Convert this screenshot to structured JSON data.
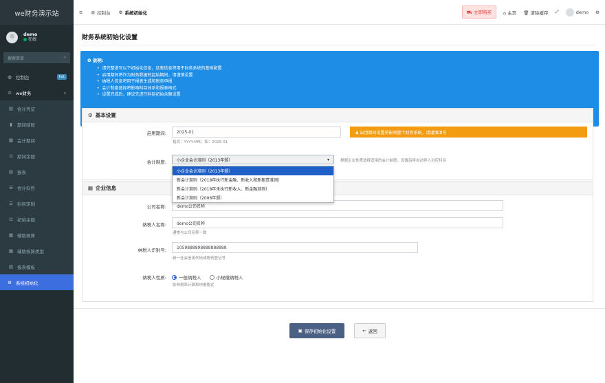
{
  "sidebar": {
    "brand": "we财务演示站",
    "user": {
      "name": "demo",
      "status": "在线"
    },
    "search_placeholder": "搜索菜单",
    "items": [
      {
        "label": "控制台",
        "icon": "dashboard-icon",
        "badge": "hot"
      },
      {
        "label": "we财务",
        "icon": "finance-icon"
      },
      {
        "label": "会计凭证",
        "icon": "voucher-icon"
      },
      {
        "label": "期间结账",
        "icon": "lock-icon"
      },
      {
        "label": "会计期间",
        "icon": "calendar-icon"
      },
      {
        "label": "期间余额",
        "icon": "balance-icon"
      },
      {
        "label": "报表",
        "icon": "report-icon"
      },
      {
        "label": "会计科目",
        "icon": "list-icon"
      },
      {
        "label": "科目定制",
        "icon": "list-icon"
      },
      {
        "label": "初始余额",
        "icon": "init-icon"
      },
      {
        "label": "辅助核算",
        "icon": "grid-icon"
      },
      {
        "label": "辅助核算类型",
        "icon": "grid-icon"
      },
      {
        "label": "报表模板",
        "icon": "template-icon"
      },
      {
        "label": "系统初始化",
        "icon": "gear-icon"
      }
    ]
  },
  "topbar": {
    "tabs": [
      {
        "label": "控制台",
        "icon": "dashboard-icon"
      },
      {
        "label": "系统初始化",
        "icon": "gear-icon"
      }
    ],
    "buy": "立即购买",
    "home": "主页",
    "clear_cache": "清除缓存",
    "user": "demo"
  },
  "page": {
    "title": "财务系统初始化设置",
    "notice_title": "说明:",
    "notice_items": [
      "请完整填写以下初始化信息，这些信息将用于财务系统的基础配置",
      "启用期间将作为财务数据的起始期间，请谨慎设置",
      "纳税人信息将用于报表生成和税务申报",
      "会计制度选择将影响科目体系和报表格式",
      "设置完成后，建议先进行科目初始余额设置"
    ],
    "basic": {
      "header": "基本设置",
      "period_label": "启用期间:",
      "period_value": "2025-01",
      "period_help": "格式：YYYY-MM，如：2025-01",
      "period_warning": "启用期间设置将影响整个财务系统，请谨慎填写",
      "system_label": "会计制度:",
      "system_value": "小企业会计准则（2013年颁）",
      "system_help": "根据企业性质选择适用的会计制度，设置后将自动导入对应科目",
      "options": [
        "小企业会计准则（2013年颁）",
        "新会计准则（2018年执行新金融、新收入和新租赁准则）",
        "新会计准则（2018年未执行新收入、新金融准则）",
        "新会计准则（2006年颁）"
      ]
    },
    "company": {
      "header": "企业信息",
      "name_label": "公司名称:",
      "name_value": "demo公司名称",
      "taxpayer_label": "纳税人名称:",
      "taxpayer_value": "demo公司名称",
      "taxpayer_help": "通常与公司名称一致",
      "taxid_label": "纳税人识别号:",
      "taxid_value": "1059888898888888888",
      "taxid_help": "统一社会信用代码或税务登记号",
      "nature_label": "纳税人性质:",
      "nature_general": "一般纳税人",
      "nature_small": "小规模纳税人",
      "nature_help": "影响税率计算和申报格式"
    },
    "save": "保存初始化设置",
    "back": "返回"
  }
}
